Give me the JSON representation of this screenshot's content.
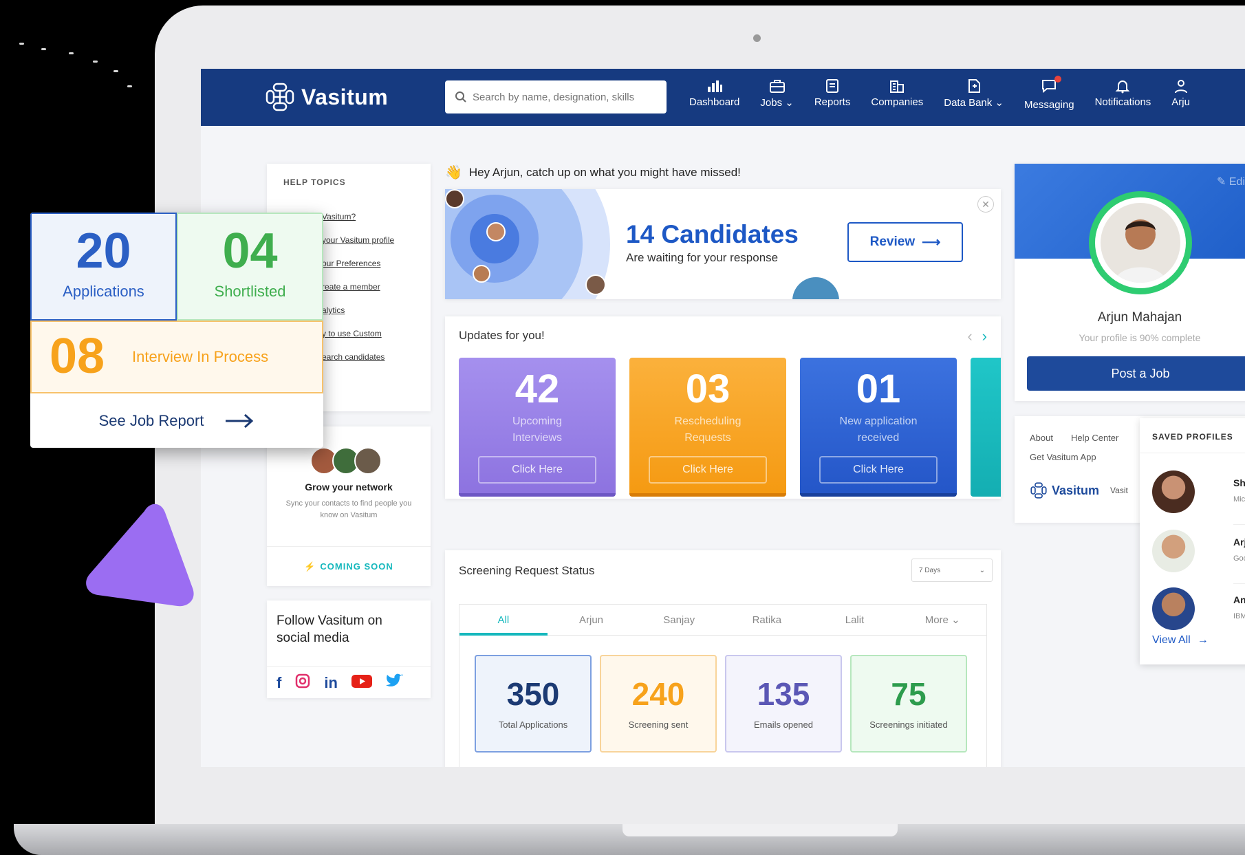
{
  "brand": {
    "name": "Vasitum"
  },
  "search": {
    "placeholder": "Search by name, designation, skills"
  },
  "nav": [
    {
      "label": "Dashboard",
      "icon": "bar-chart-icon"
    },
    {
      "label": "Jobs",
      "icon": "briefcase-icon",
      "dropdown": true
    },
    {
      "label": "Reports",
      "icon": "report-icon"
    },
    {
      "label": "Companies",
      "icon": "building-icon"
    },
    {
      "label": "Data Bank",
      "icon": "file-icon",
      "dropdown": true
    },
    {
      "label": "Messaging",
      "icon": "chat-icon",
      "badge": true
    },
    {
      "label": "Notifications",
      "icon": "bell-icon"
    },
    {
      "label": "Arju",
      "icon": "user-icon"
    }
  ],
  "help": {
    "title": "HELP TOPICS",
    "links": [
      "Vasitum?",
      "your Vasitum profile",
      "our Preferences",
      "reate a member",
      "alytics",
      "y to use Custom",
      "earch candidates"
    ]
  },
  "network": {
    "title": "Grow your network",
    "subtitle": "Sync your contacts to find people you know on Vasitum",
    "coming_soon": "COMING SOON"
  },
  "social": {
    "title": "Follow Vasitum on social media"
  },
  "greeting": "Hey Arjun, catch up on what you might have missed!",
  "candidates": {
    "title": "14 Candidates",
    "subtitle": "Are waiting for your response",
    "review": "Review"
  },
  "updates": {
    "title": "Updates for you!",
    "tiles": [
      {
        "num": "42",
        "line1": "Upcoming",
        "line2": "Interviews",
        "cta": "Click Here",
        "color": "#9a84e8"
      },
      {
        "num": "03",
        "line1": "Rescheduling",
        "line2": "Requests",
        "cta": "Click Here",
        "color": "#f7a21b"
      },
      {
        "num": "01",
        "line1": "New application",
        "line2": "received",
        "cta": "Click Here",
        "color": "#2a62d6"
      }
    ]
  },
  "screening": {
    "title": "Screening Request Status",
    "range": "7 Days",
    "tabs": [
      "All",
      "Arjun",
      "Sanjay",
      "Ratika",
      "Lalit",
      "More"
    ],
    "stats": [
      {
        "num": "350",
        "label": "Total Applications",
        "color": "#1c3a73"
      },
      {
        "num": "240",
        "label": "Screening sent",
        "color": "#f7a21b"
      },
      {
        "num": "135",
        "label": "Emails opened",
        "color": "#5b57b5"
      },
      {
        "num": "75",
        "label": "Screenings initiated",
        "color": "#2d9c4d"
      }
    ]
  },
  "profile": {
    "edit": "Edi",
    "name": "Arjun Mahajan",
    "completion": "Your profile is 90% complete",
    "progress": 0.9,
    "post_job": "Post a Job"
  },
  "footer": {
    "links": [
      "About",
      "Help Center"
    ],
    "app": "Get Vasitum App",
    "brand": "Vasitum",
    "brand_tail": "Vasit"
  },
  "saved": {
    "title": "SAVED PROFILES",
    "items": [
      {
        "name": "Shar",
        "company": "Micro"
      },
      {
        "name": "Arju",
        "company": "Goog"
      },
      {
        "name": "Ankit",
        "company": "IBM, "
      }
    ],
    "view_all": "View All"
  },
  "overlay": {
    "applications": {
      "num": "20",
      "label": "Applications",
      "color": "#2b5fc4"
    },
    "shortlisted": {
      "num": "04",
      "label": "Shortlisted",
      "color": "#3fae4e"
    },
    "interview": {
      "num": "08",
      "label": "Interview In Process",
      "color": "#f7a21b"
    },
    "report": "See Job Report"
  }
}
